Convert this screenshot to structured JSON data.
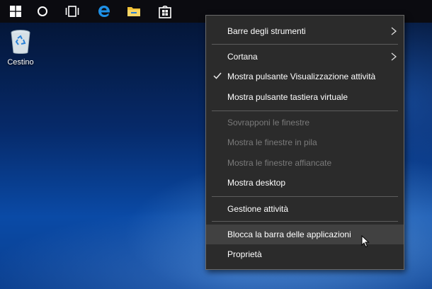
{
  "taskbar": {
    "icons": [
      "windows-start-icon",
      "cortana-search-icon",
      "task-view-icon",
      "edge-browser-icon",
      "file-explorer-icon",
      "store-icon"
    ]
  },
  "desktop": {
    "recycle_bin_label": "Cestino"
  },
  "menu": {
    "items": [
      {
        "label": "Barre degli strumenti",
        "submenu": true
      },
      {
        "label": "Cortana",
        "submenu": true
      },
      {
        "label": "Mostra pulsante Visualizzazione attività",
        "checked": true
      },
      {
        "label": "Mostra pulsante tastiera virtuale"
      },
      {
        "label": "Sovrapponi le finestre",
        "disabled": true
      },
      {
        "label": "Mostra le finestre in pila",
        "disabled": true
      },
      {
        "label": "Mostra le finestre affiancate",
        "disabled": true
      },
      {
        "label": "Mostra desktop"
      },
      {
        "label": "Gestione attività"
      },
      {
        "label": "Blocca la barra delle applicazioni",
        "highlighted": true
      },
      {
        "label": "Proprietà"
      }
    ]
  },
  "colors": {
    "menu_bg": "#2b2b2b",
    "menu_hover": "#414141",
    "menu_disabled_text": "#7a7a7a",
    "edge_blue": "#1e90e6",
    "explorer_yellow": "#f2c237"
  }
}
